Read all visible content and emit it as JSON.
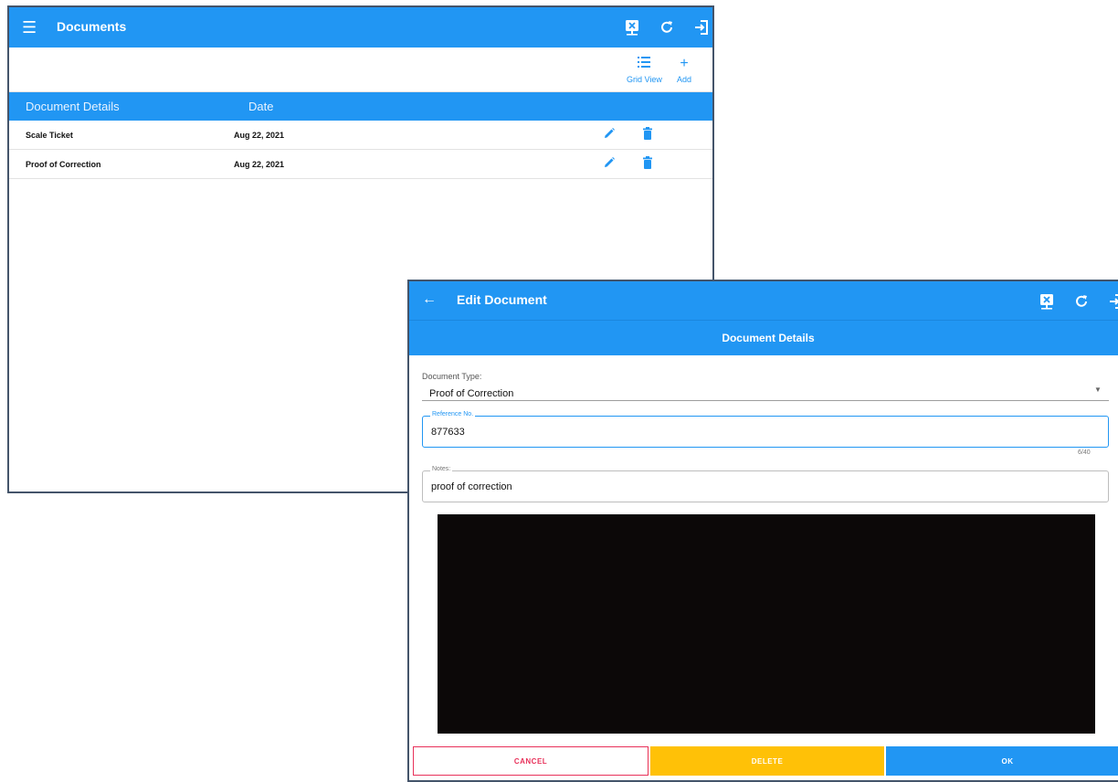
{
  "documents_window": {
    "title": "Documents",
    "toolbar": {
      "grid_view_label": "Grid View",
      "add_label": "Add"
    },
    "columns": [
      "Document Details",
      "Date"
    ],
    "rows": [
      {
        "name": "Scale Ticket",
        "date": "Aug 22, 2021"
      },
      {
        "name": "Proof of Correction",
        "date": "Aug 22, 2021"
      }
    ]
  },
  "edit_window": {
    "title": "Edit Document",
    "section_header": "Document Details",
    "document_type": {
      "label": "Document Type:",
      "value": "Proof of Correction"
    },
    "reference_no": {
      "label": "Reference No.",
      "value": "877633",
      "counter": "6/40"
    },
    "notes": {
      "label": "Notes:",
      "value": "proof of correction"
    },
    "buttons": {
      "cancel": "CANCEL",
      "delete": "DELETE",
      "ok": "OK"
    }
  },
  "icons": [
    "menu-icon",
    "back-arrow-icon",
    "device-disconnect-icon",
    "refresh-icon",
    "logout-icon",
    "grid-view-icon",
    "add-icon",
    "edit-pencil-icon",
    "delete-trash-icon",
    "dropdown-caret-icon"
  ],
  "colors": {
    "primary": "#2196f3",
    "cancel": "#e8315a",
    "delete": "#ffc107",
    "frame": "#44546a"
  }
}
